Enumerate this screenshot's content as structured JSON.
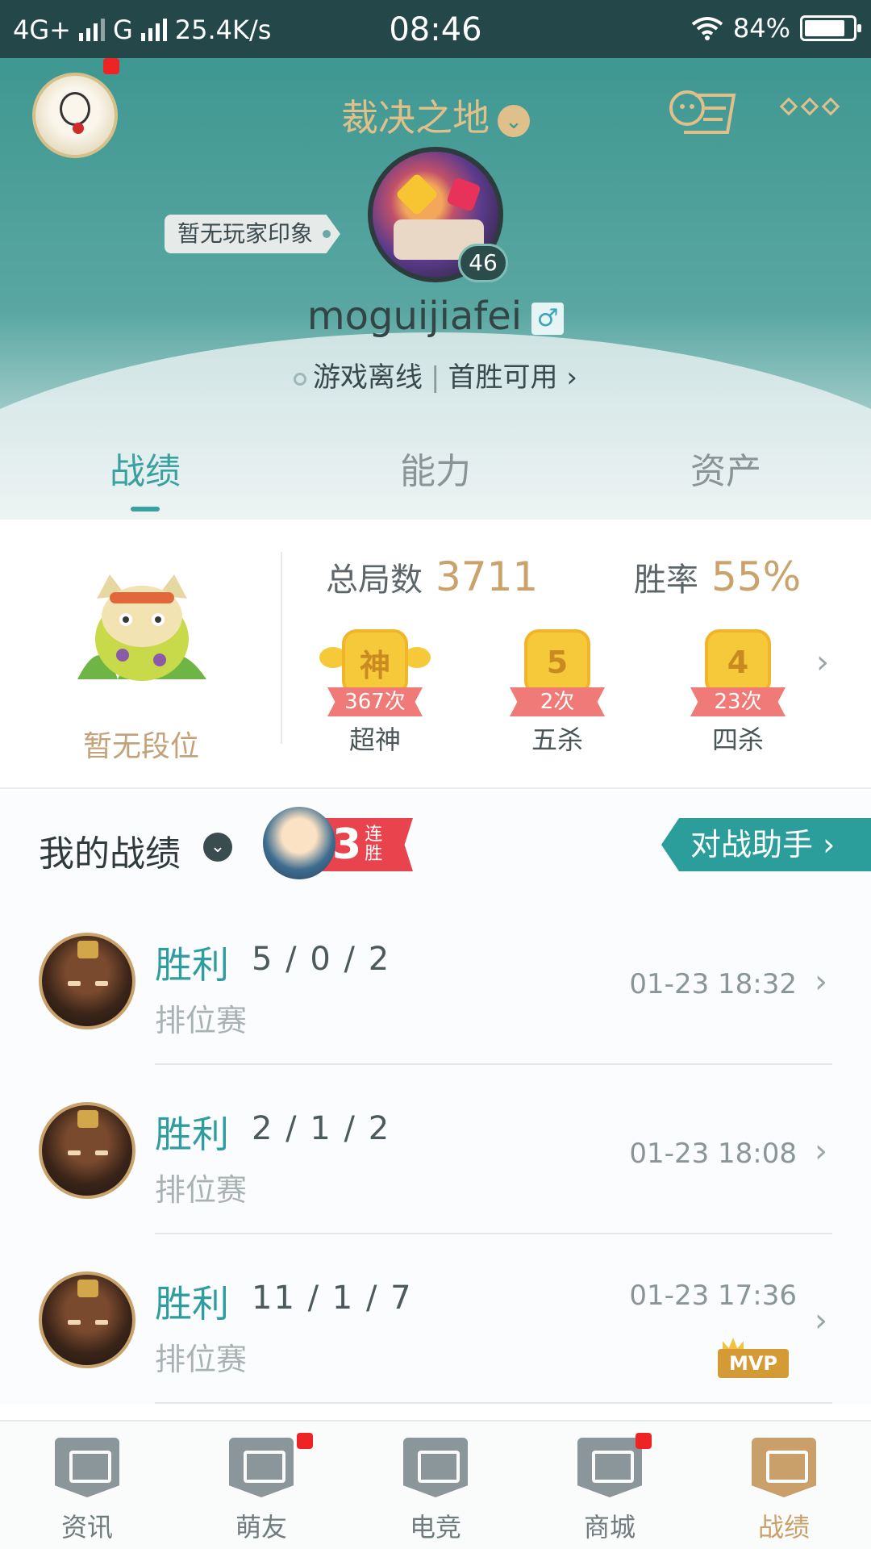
{
  "statusbar": {
    "network1": "4G+",
    "network2": "G",
    "speed": "25.4K/s",
    "time": "08:46",
    "battery": "84%",
    "battery_level": 0.84
  },
  "header": {
    "server_name": "裁决之地",
    "impression_tag": "暂无玩家印象",
    "level": "46",
    "username": "moguijiafei",
    "gender_symbol": "♂",
    "game_status": "游戏离线",
    "first_win": "首胜可用",
    "first_win_arrow": "›"
  },
  "tabs": [
    {
      "label": "战绩",
      "active": true
    },
    {
      "label": "能力",
      "active": false
    },
    {
      "label": "资产",
      "active": false
    }
  ],
  "stats": {
    "rank_label": "暂无段位",
    "total_label": "总局数",
    "total_value": "3711",
    "winrate_label": "胜率",
    "winrate_value": "55%",
    "medals": [
      {
        "glyph": "神",
        "count": "367次",
        "name": "超神"
      },
      {
        "glyph": "5",
        "count": "2次",
        "name": "五杀"
      },
      {
        "glyph": "4",
        "count": "23次",
        "name": "四杀"
      }
    ],
    "more_arrow": "›"
  },
  "records": {
    "title": "我的战绩",
    "streak_number": "3",
    "streak_text": "连胜",
    "assistant_label": "对战助手 ›",
    "matches": [
      {
        "result": "胜利",
        "kda": "5 / 0 / 2",
        "mode": "排位赛",
        "time": "01-23 18:32",
        "mvp": false
      },
      {
        "result": "胜利",
        "kda": "2 / 1 / 2",
        "mode": "排位赛",
        "time": "01-23 18:08",
        "mvp": false
      },
      {
        "result": "胜利",
        "kda": "11 / 1 / 7",
        "mode": "排位赛",
        "time": "01-23 17:36",
        "mvp": true
      }
    ],
    "mvp_label": "MVP",
    "row_arrow": "›"
  },
  "bottomnav": [
    {
      "label": "资讯",
      "active": false,
      "badge": false
    },
    {
      "label": "萌友",
      "active": false,
      "badge": true
    },
    {
      "label": "电竞",
      "active": false,
      "badge": false
    },
    {
      "label": "商城",
      "active": false,
      "badge": true
    },
    {
      "label": "战绩",
      "active": true,
      "badge": false
    }
  ],
  "colors": {
    "accent_teal": "#2b9d9a",
    "gold": "#c9a06a",
    "header_teal": "#3f9791",
    "badge_red": "#ee2424"
  }
}
